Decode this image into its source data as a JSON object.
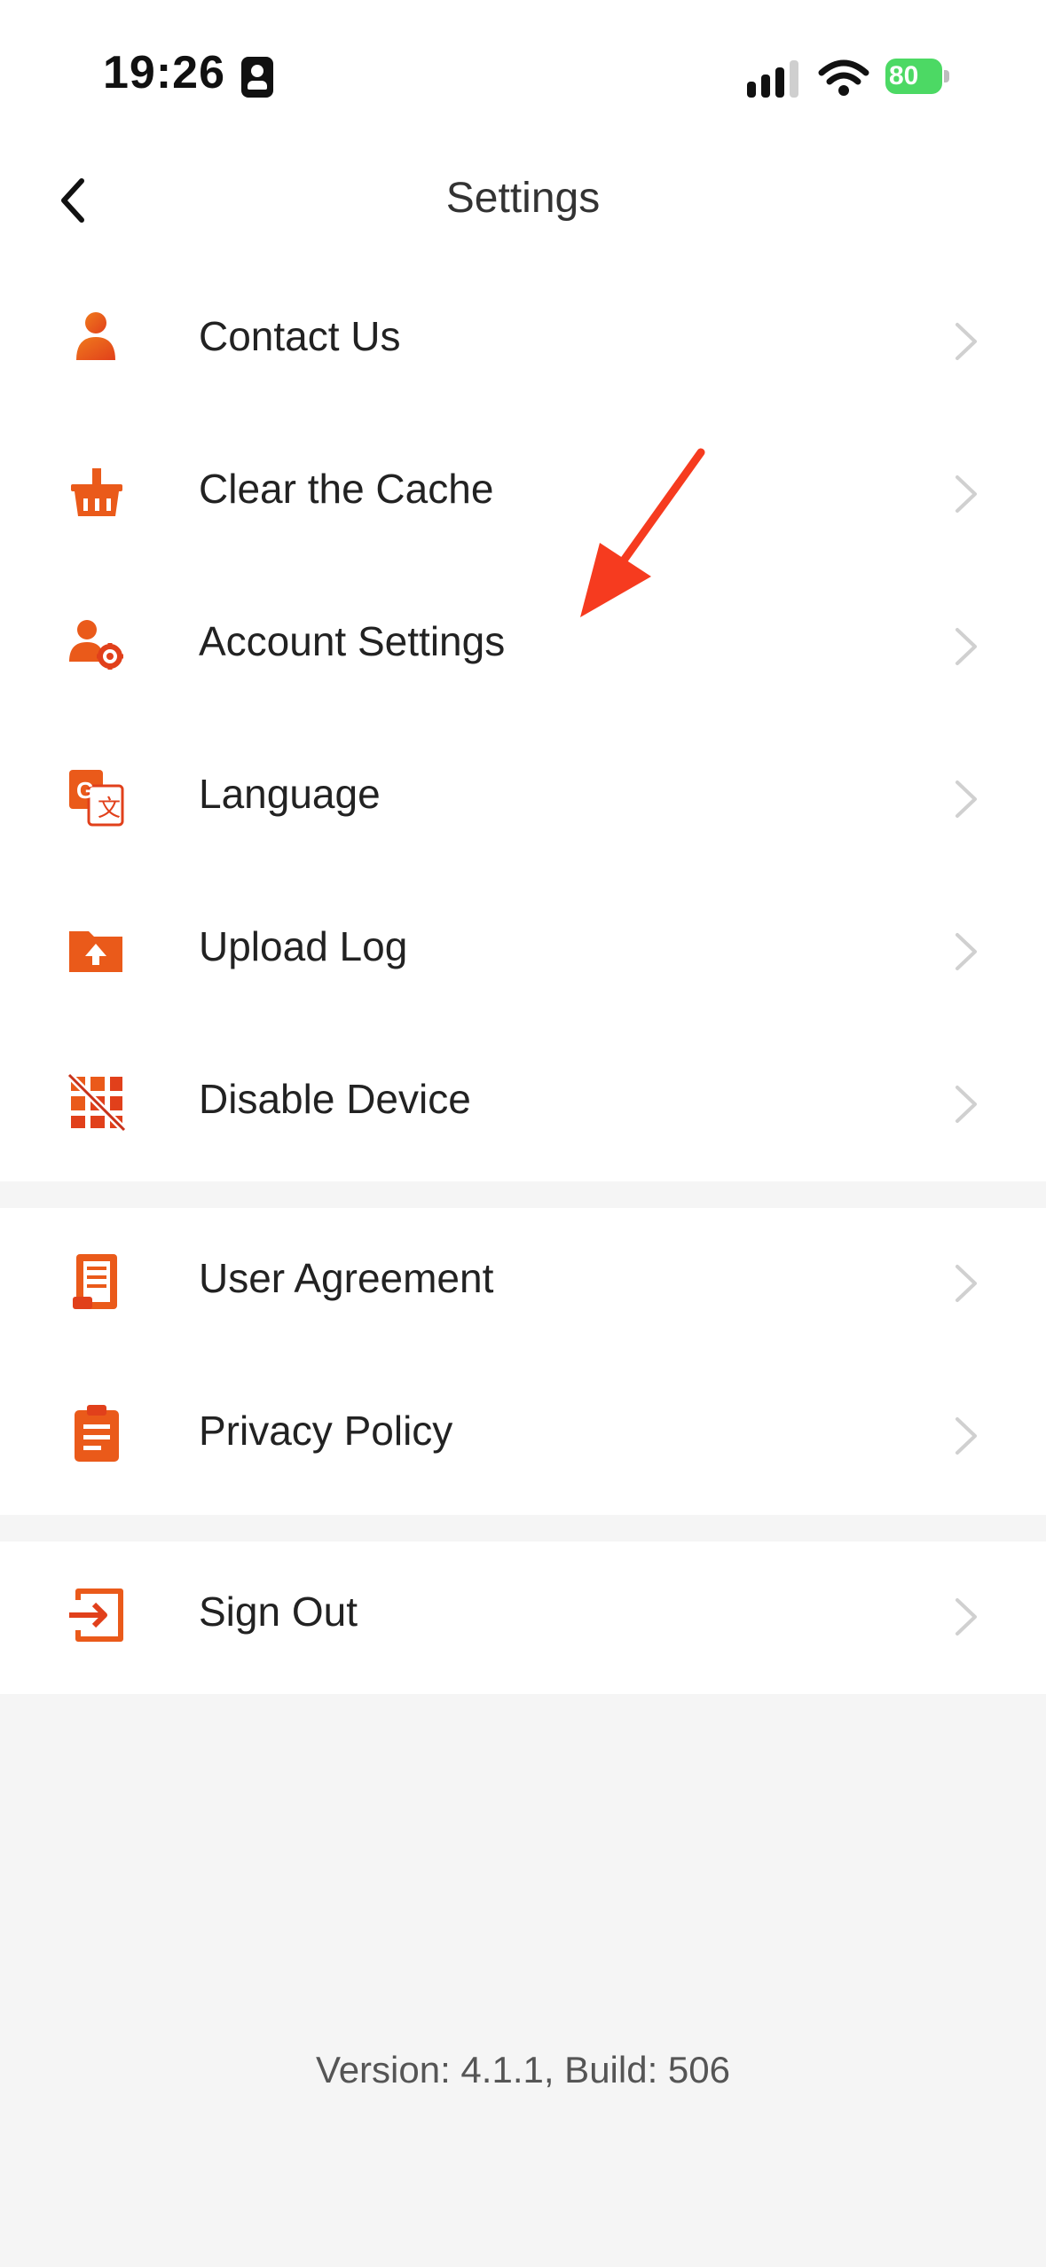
{
  "status_bar": {
    "time": "19:26",
    "battery": "80"
  },
  "header": {
    "title": "Settings"
  },
  "groups": [
    {
      "items": [
        {
          "label": "Contact Us",
          "icon": "user-icon"
        },
        {
          "label": "Clear the Cache",
          "icon": "basket-icon"
        },
        {
          "label": "Account Settings",
          "icon": "user-gear-icon"
        },
        {
          "label": "Language",
          "icon": "translate-icon"
        },
        {
          "label": "Upload Log",
          "icon": "folder-upload-icon"
        },
        {
          "label": "Disable Device",
          "icon": "disable-grid-icon"
        }
      ]
    },
    {
      "items": [
        {
          "label": "User Agreement",
          "icon": "document-icon"
        },
        {
          "label": "Privacy Policy",
          "icon": "clipboard-icon"
        }
      ]
    },
    {
      "items": [
        {
          "label": "Sign Out",
          "icon": "sign-out-icon"
        }
      ]
    }
  ],
  "footer": {
    "version": "Version: 4.1.1, Build: 506"
  },
  "colors": {
    "accent": "#ea5a1a",
    "annotation": "#f63b1f",
    "background": "#f5f5f5"
  }
}
